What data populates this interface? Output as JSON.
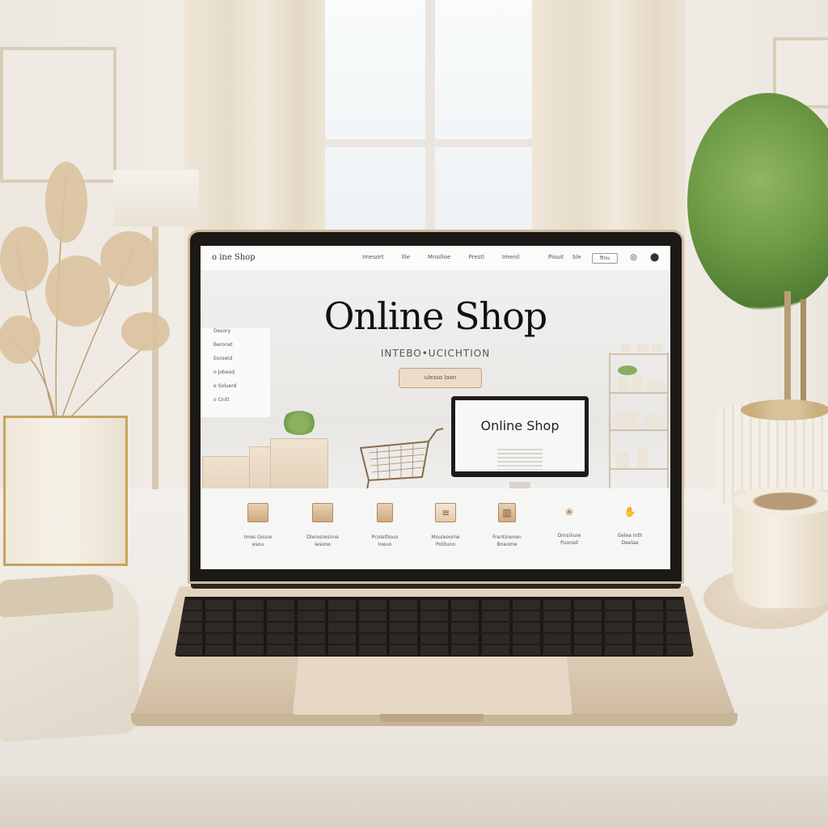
{
  "site": {
    "brand": "o ine Shop",
    "nav_links": [
      "Imesort",
      "llle",
      "Mnsilloe",
      "Prestl",
      "Imenil"
    ],
    "nav_right_link": "Piouit",
    "nav_right_link2": "ble",
    "search_label": "ftnu",
    "icons": [
      "account-icon",
      "cart-icon"
    ]
  },
  "hero": {
    "title": "Online Shop",
    "subtitle": "INTEBO•UCICHTION",
    "cta_label": "ulesso loon"
  },
  "sidebar": {
    "items": [
      "Desory",
      "Beronet",
      "Eoroetd",
      "o Jobeod",
      "e Soluerd",
      "o Cnitl"
    ]
  },
  "monitor": {
    "title": "Online Shop"
  },
  "categories": [
    {
      "label": "Imes Goure\nesou",
      "icon": "box-icon"
    },
    {
      "label": "Dlerosresnne\nIesone",
      "icon": "frame-icon"
    },
    {
      "label": "Pcoleltiouo\nIoeuo",
      "icon": "package-icon"
    },
    {
      "label": "Mouleoorne\nPolituno",
      "icon": "document-icon"
    },
    {
      "label": "Frentinenen\nBneome",
      "icon": "gift-icon"
    },
    {
      "label": "Drnsiiiure\nPuonsd",
      "icon": "bag-icon"
    },
    {
      "label": "Gelea Inth\nDeelae",
      "icon": "hand-icon"
    }
  ],
  "colors": {
    "accent": "#c79e79",
    "laptop_body": "#dac8b0",
    "plant": "#6e9a45"
  }
}
